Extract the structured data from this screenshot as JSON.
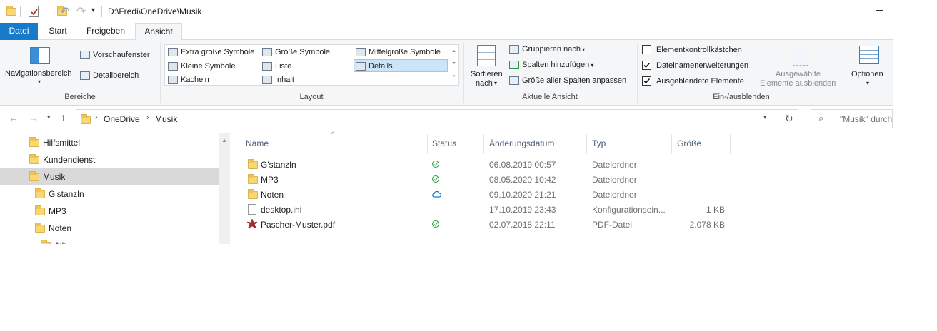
{
  "titlebar": {
    "path": "D:\\Fredi\\OneDrive\\Musik"
  },
  "tabs": {
    "datei": "Datei",
    "start": "Start",
    "freigeben": "Freigeben",
    "ansicht": "Ansicht"
  },
  "ribbon": {
    "bereiche": {
      "navigationsbereich": "Navigationsbereich",
      "vorschaufenster": "Vorschaufenster",
      "detailbereich": "Detailbereich",
      "label": "Bereiche"
    },
    "layout": {
      "items": [
        "Extra große Symbole",
        "Große Symbole",
        "Mittelgroße Symbole",
        "Kleine Symbole",
        "Liste",
        "Details",
        "Kacheln",
        "Inhalt"
      ],
      "label": "Layout"
    },
    "ansicht": {
      "sortieren": "Sortieren",
      "nach": "nach",
      "gruppieren": "Gruppieren nach",
      "spalten": "Spalten hinzufügen",
      "groesse": "Größe aller Spalten anpassen",
      "label": "Aktuelle Ansicht"
    },
    "einaus": {
      "chk1": "Elementkontrollkästchen",
      "chk2": "Dateinamenerweiterungen",
      "chk3": "Ausgeblendete Elemente",
      "chk1_checked": false,
      "chk2_checked": true,
      "chk3_checked": true,
      "hide_line1": "Ausgewählte",
      "hide_line2": "Elemente ausblenden",
      "label": "Ein-/ausblenden"
    },
    "optionen": "Optionen"
  },
  "address": {
    "crumb1": "OneDrive",
    "crumb2": "Musik"
  },
  "search": {
    "placeholder": "\"Musik\" durch"
  },
  "nav": {
    "items": [
      "Hilfsmittel",
      "Kundendienst",
      "Musik",
      "G'stanzln",
      "MP3",
      "Noten"
    ],
    "partial": "Alb"
  },
  "columns": {
    "name": "Name",
    "status": "Status",
    "datum": "Änderungsdatum",
    "typ": "Typ",
    "groesse": "Größe"
  },
  "files": [
    {
      "name": "G'stanzln",
      "status": "synced",
      "datum": "06.08.2019 00:57",
      "typ": "Dateiordner",
      "groesse": ""
    },
    {
      "name": "MP3",
      "status": "synced",
      "datum": "08.05.2020 10:42",
      "typ": "Dateiordner",
      "groesse": ""
    },
    {
      "name": "Noten",
      "status": "cloud",
      "datum": "09.10.2020 21:21",
      "typ": "Dateiordner",
      "groesse": ""
    },
    {
      "name": "desktop.ini",
      "status": "",
      "datum": "17.10.2019 23:43",
      "typ": "Konfigurationsein...",
      "groesse": "1 KB"
    },
    {
      "name": "Pascher-Muster.pdf",
      "status": "synced",
      "datum": "02.07.2018 22:11",
      "typ": "PDF-Datei",
      "groesse": "2.078 KB"
    }
  ],
  "colors": {
    "accent": "#1979ca",
    "selection": "#cce4f7",
    "nav_selected": "#d9d9d9",
    "synced": "#2b9a3c",
    "cloud": "#1979ca"
  }
}
